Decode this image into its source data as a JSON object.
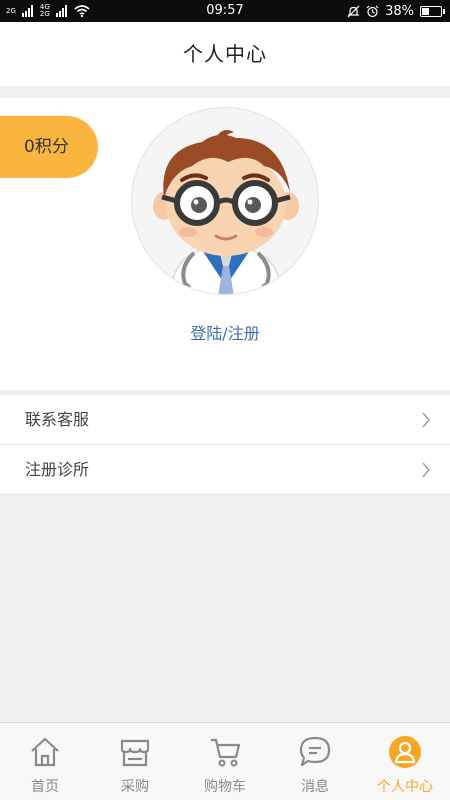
{
  "status_bar": {
    "signal1": "2G",
    "signal2_top": "4G",
    "signal2_bottom": "2G",
    "time": "09:57",
    "battery": "38%",
    "battery_level": 0.38
  },
  "header": {
    "title": "个人中心"
  },
  "profile": {
    "points_label": "0积分",
    "login_label": "登陆/注册"
  },
  "menu": [
    {
      "label": "联系客服"
    },
    {
      "label": "注册诊所"
    }
  ],
  "bottom_nav": [
    {
      "label": "首页",
      "icon": "home-icon"
    },
    {
      "label": "采购",
      "icon": "store-icon"
    },
    {
      "label": "购物车",
      "icon": "cart-icon"
    },
    {
      "label": "消息",
      "icon": "chat-icon"
    },
    {
      "label": "个人中心",
      "icon": "person-icon",
      "active": true
    }
  ],
  "colors": {
    "accent": "#f6a623",
    "badge": "#f9b53d",
    "link": "#3b6fb2"
  }
}
